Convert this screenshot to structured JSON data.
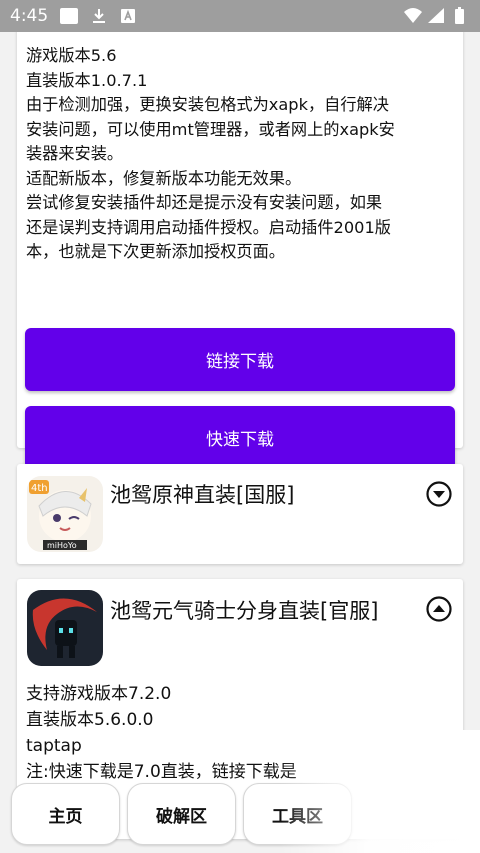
{
  "status_bar": {
    "time": "4:45",
    "icons": [
      "notification-square-icon",
      "download-icon",
      "a-badge-icon",
      "wifi-icon",
      "signal-icon",
      "battery-icon"
    ]
  },
  "card1": {
    "lines": [
      "游戏版本5.6",
      "直装版本1.0.7.1",
      "由于检测加强，更换安装包格式为xapk，自行解决",
      "安装问题，可以使用mt管理器，或者网上的xapk安",
      "装器来安装。",
      "适配新版本，修复新版本功能无效果。",
      "尝试修复安装插件却还是提示没有安装问题，如果",
      "还是误判支持调用启动插件授权。启动插件2001版",
      "本，也就是下次更新添加授权页面。"
    ],
    "link_download": "链接下载",
    "fast_download": "快速下载"
  },
  "card2": {
    "title": "池鸳原神直装[国服]",
    "icon": "genshin-app-icon",
    "toggle": "expand"
  },
  "card3": {
    "title": "池鸳元气骑士分身直装[官服]",
    "icon": "soul-knight-app-icon",
    "toggle": "collapse",
    "details": [
      "支持游戏版本7.2.0",
      "直装版本5.6.0.0",
      "taptap",
      "注:快速下载是7.0直装，链接下载是"
    ]
  },
  "nav": {
    "home": "主页",
    "crack": "破解区",
    "tools": "工具区"
  },
  "colors": {
    "accent": "#6200ea",
    "status_bar": "#9e9e9e",
    "background": "#f2f2f2"
  }
}
